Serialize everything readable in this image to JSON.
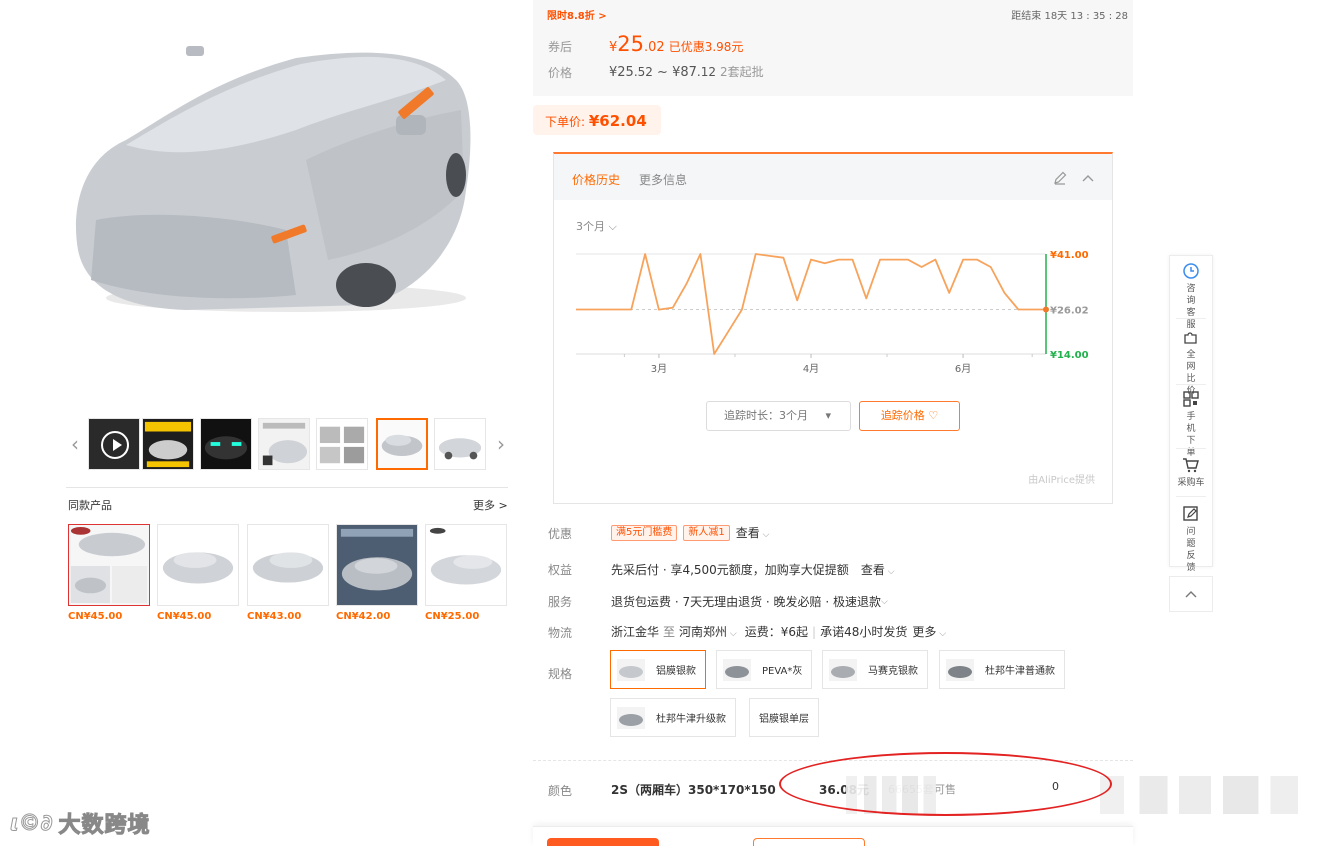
{
  "flash_sale": {
    "label": "限时8.8折 >",
    "countdown": "距结束 18天 13 : 35 : 28"
  },
  "price": {
    "coupon_label": "券后",
    "coupon_currency": "¥",
    "coupon_int": "25",
    "coupon_dec": ".02",
    "saved": "已优惠3.98元",
    "range_label": "价格",
    "range_min_int": "¥25",
    "range_min_dec": ".52",
    "range_sep": " ~ ",
    "range_max_int": "¥87",
    "range_max_dec": ".12",
    "moq": "2套起批",
    "order_label": "下单价:",
    "order_value": "¥62.04"
  },
  "price_history": {
    "tab_active": "价格历史",
    "tab_other": "更多信息",
    "period": "3个月",
    "track_duration": "追踪时长：3个月",
    "track_button": "追踪价格",
    "source": "由AliPrice提供"
  },
  "chart_data": {
    "type": "line",
    "x_ticks": [
      "3月",
      "4月",
      "6月"
    ],
    "y_labels": {
      "max": "¥41.00",
      "current": "¥26.02",
      "min": "¥14.00"
    },
    "ylim": [
      14,
      41
    ],
    "points": [
      26.02,
      26.02,
      26.02,
      26.02,
      26.02,
      41.0,
      26.0,
      26.5,
      33.0,
      41.0,
      14.0,
      20.0,
      26.0,
      41.0,
      40.5,
      40.0,
      28.5,
      39.5,
      38.5,
      39.5,
      39.5,
      29.0,
      39.5,
      39.5,
      39.5,
      37.5,
      39.5,
      30.5,
      39.5,
      39.5,
      37.5,
      30.5,
      26.02,
      26.02,
      26.02
    ],
    "point_index_of_ticks": [
      6,
      17,
      28
    ]
  },
  "rows": {
    "promo": {
      "label": "优惠",
      "tags": [
        "满5元门槛费",
        "新人减1"
      ],
      "more": "查看"
    },
    "rights": {
      "label": "权益",
      "text": "先采后付 · 享4,500元额度，加购享大促提额",
      "more": "查看"
    },
    "service": {
      "label": "服务",
      "text": "退货包运费 · 7天无理由退货 · 晚发必赔 · 极速退款"
    },
    "logistics": {
      "label": "物流",
      "from": "浙江金华",
      "to_word": "至",
      "to": "河南郑州",
      "fee": "运费：¥6起",
      "promise": "承诺48小时发货",
      "more": "更多"
    },
    "spec": {
      "label": "规格",
      "options": [
        "铝膜银款",
        "PEVA*灰",
        "马赛克银款",
        "杜邦牛津普通款",
        "杜邦牛津升级款",
        "铝膜银单层"
      ]
    },
    "color": {
      "label": "颜色",
      "sku_name": "2S（两厢车）350*170*150",
      "sku_price": "36.08元",
      "sku_stock": "66655套可售",
      "qty": "0"
    }
  },
  "same_products": {
    "title": "同款产品",
    "more": "更多 >",
    "prices": [
      "CN¥45.00",
      "CN¥45.00",
      "CN¥43.00",
      "CN¥42.00",
      "CN¥25.00"
    ]
  },
  "float_toolbar": {
    "consult": "咨询客服",
    "compare": "全网比价",
    "mobile": "手机下单",
    "cart": "采购车",
    "feedback": "问题反馈"
  },
  "watermark": "大数跨境",
  "colors": {
    "accent": "#ff6a00",
    "price": "#ff5000",
    "ring": "#e32222"
  }
}
